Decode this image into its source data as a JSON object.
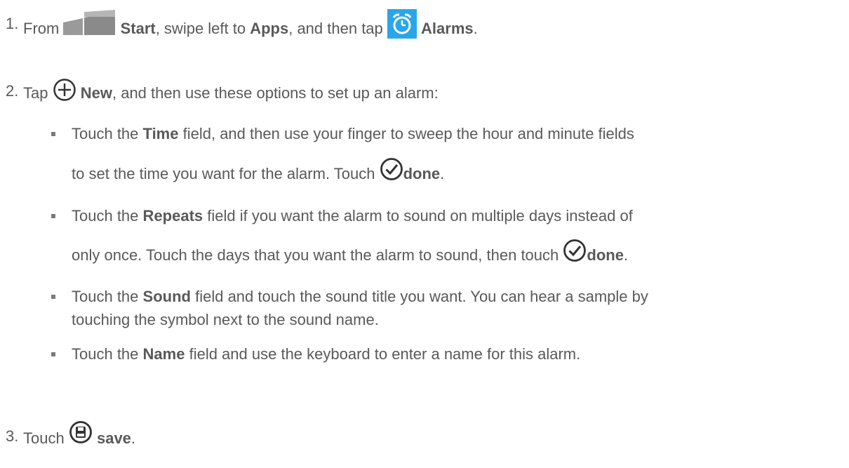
{
  "steps": [
    {
      "number": "1.",
      "parts": [
        "From",
        "Start",
        ", swipe left to",
        "Apps",
        ", and then tap",
        "Alarms",
        "."
      ],
      "icons": [
        "windows-start-icon",
        "alarm-clock-icon"
      ]
    },
    {
      "number": "2.",
      "parts": [
        "Tap",
        "New",
        ", and then use these options to set up an alarm:"
      ],
      "icons": [
        "plus-circle-icon"
      ]
    },
    {
      "number": "3.",
      "parts": [
        "Touch",
        "save",
        "."
      ],
      "icons": [
        "save-circle-icon"
      ]
    }
  ],
  "bullets": [
    {
      "line1": [
        "Touch the",
        "Time",
        "field, and then use your finger to sweep the hour and minute fields"
      ],
      "line2": [
        "to set the time you want for the alarm. Touch",
        "done",
        "."
      ]
    },
    {
      "line1": [
        "Touch the",
        "Repeats",
        "field if you want the alarm to sound on multiple days instead of"
      ],
      "line2": [
        "only once. Touch the days that you want the alarm to sound, then touch",
        "done",
        "."
      ]
    },
    {
      "line1": [
        "Touch the",
        "Sound",
        "field and touch the sound title you want. You can hear a sample by"
      ],
      "line2": [
        "touching the symbol next to the sound name."
      ]
    },
    {
      "line1": [
        "Touch the",
        "Name",
        "field and use the keyboard to enter a name for this alarm."
      ]
    }
  ],
  "colors": {
    "text": "#595959",
    "alarm_tile": "#2aa6e8"
  }
}
